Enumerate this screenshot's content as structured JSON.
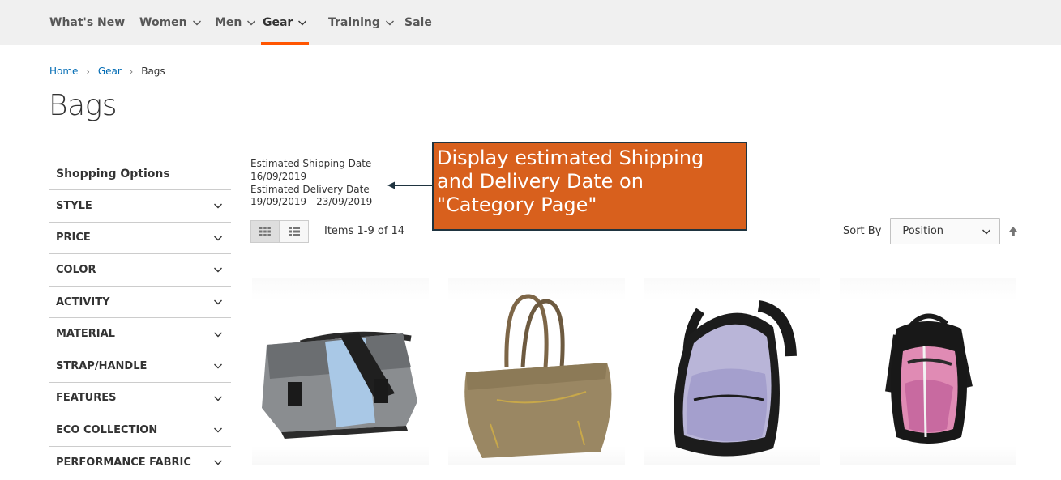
{
  "nav": {
    "items": [
      {
        "label": "What's New",
        "dropdown": false
      },
      {
        "label": "Women",
        "dropdown": true
      },
      {
        "label": "Men",
        "dropdown": true
      },
      {
        "label": "Gear",
        "dropdown": true,
        "active": true
      },
      {
        "label": "Training",
        "dropdown": true
      },
      {
        "label": "Sale",
        "dropdown": false
      }
    ],
    "accent": "#ff5501"
  },
  "breadcrumb": {
    "home": "Home",
    "gear": "Gear",
    "current": "Bags",
    "separator": "›"
  },
  "page": {
    "title": "Bags"
  },
  "sidebar": {
    "title": "Shopping Options",
    "filters": [
      "STYLE",
      "PRICE",
      "COLOR",
      "ACTIVITY",
      "MATERIAL",
      "STRAP/HANDLE",
      "FEATURES",
      "ECO COLLECTION",
      "PERFORMANCE FABRIC"
    ]
  },
  "shipping": {
    "shipping_label": "Estimated Shipping Date",
    "shipping_date": "16/09/2019",
    "delivery_label": "Estimated Delivery Date",
    "delivery_range": "19/09/2019 - 23/09/2019"
  },
  "annotation": {
    "line1": "Display estimated Shipping",
    "line2": "and Delivery Date on",
    "line3": "\"Category Page\"",
    "background": "#d8601d",
    "border": "#1f3440"
  },
  "toolbar": {
    "grid_icon": "grid-view-icon",
    "list_icon": "list-view-icon",
    "items_count": "Items 1-9 of 14",
    "sort_label": "Sort By",
    "sort_value": "Position",
    "sort_direction_icon": "arrow-up-icon"
  },
  "products": [
    {
      "image": "messenger-bag-gray-blue"
    },
    {
      "image": "tan-duffle-handbag"
    },
    {
      "image": "lavender-black-backpack"
    },
    {
      "image": "pink-black-backpack"
    }
  ]
}
